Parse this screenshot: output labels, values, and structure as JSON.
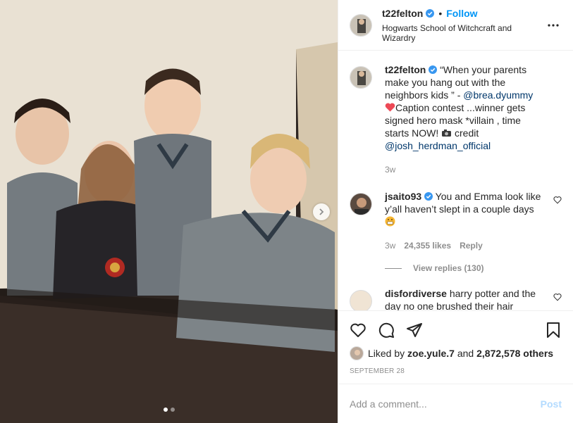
{
  "post": {
    "username": "t22felton",
    "follow_label": "Follow",
    "separator": "•",
    "location": "Hogwarts School of Witchcraft and Wizardry",
    "more_icon": "more-horizontal-icon"
  },
  "media": {
    "carousel_dots": 2,
    "active_dot": 0,
    "next_icon": "chevron-right-icon"
  },
  "caption": {
    "username": "t22felton",
    "text_1": "“When your parents make you hang out with the neighbors kids ” - ",
    "mention_1": "@brea.dyummy",
    "text_2": "Caption contest ...winner gets signed hero mask *villain , time starts NOW! ",
    "text_3": " credit ",
    "mention_2": "@josh_herdman_official",
    "time": "3w"
  },
  "comments": [
    {
      "username": "jsaito93",
      "text": "You and Emma look like y’all haven’t slept in a couple days",
      "time": "3w",
      "likes": "24,355 likes",
      "reply": "Reply",
      "view_replies": "View replies (130)"
    },
    {
      "username": "disfordiverse",
      "text": "harry potter and the day no one brushed their hair"
    }
  ],
  "actions": {
    "like_icon": "heart-icon",
    "comment_icon": "comment-icon",
    "share_icon": "share-icon",
    "save_icon": "bookmark-icon",
    "liked_by_prefix": "Liked by ",
    "liked_by_user": "zoe.yule.7",
    "liked_by_and": " and ",
    "liked_by_count": "2,872,578 others",
    "date": "SEPTEMBER 28"
  },
  "add_comment": {
    "placeholder": "Add a comment...",
    "post_label": "Post"
  },
  "colors": {
    "accent": "#0095f6",
    "link": "#00376b",
    "muted": "#8e8e8e",
    "post_disabled": "#b3dbff",
    "heart_emoji": "#ed4956"
  }
}
